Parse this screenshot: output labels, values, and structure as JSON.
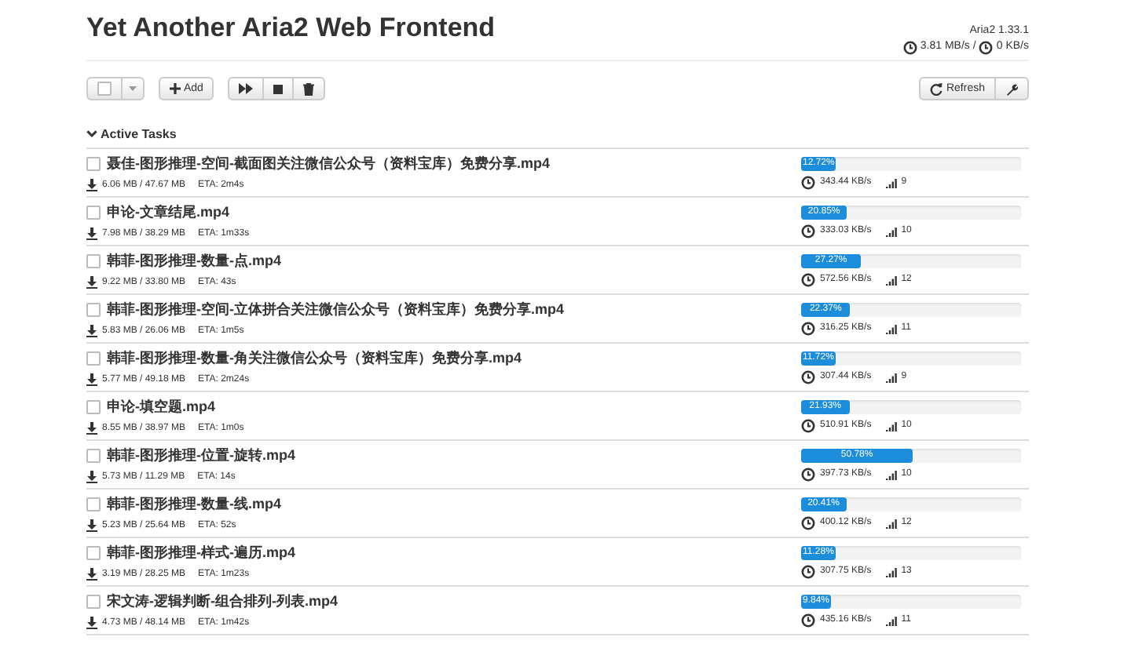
{
  "header": {
    "title": "Yet Another Aria2 Web Frontend",
    "version": "Aria2 1.33.1",
    "download_speed": "3.81 MB/s",
    "separator": "/",
    "upload_speed": "0 KB/s"
  },
  "toolbar": {
    "select_all": {
      "checked": false
    },
    "add_label": "Add",
    "refresh_label": "Refresh"
  },
  "section": {
    "title": "Active Tasks",
    "expanded": true
  },
  "tasks": [
    {
      "name": "聂佳-图形推理-空间-截面图关注微信公众号（资料宝库）免费分享.mp4",
      "checked": false,
      "size": "6.06 MB / 47.67 MB",
      "eta": "ETA: 2m4s",
      "level": 0.1272,
      "percent": "12.72%",
      "speed": "343.44 KB/s",
      "connections": "9"
    },
    {
      "name": "申论-文章结尾.mp4",
      "checked": false,
      "size": "7.98 MB / 38.29 MB",
      "eta": "ETA: 1m33s",
      "level": 0.2085,
      "percent": "20.85%",
      "speed": "333.03 KB/s",
      "connections": "10"
    },
    {
      "name": "韩菲-图形推理-数量-点.mp4",
      "checked": false,
      "size": "9.22 MB / 33.80 MB",
      "eta": "ETA: 43s",
      "level": 0.2727,
      "percent": "27.27%",
      "speed": "572.56 KB/s",
      "connections": "12"
    },
    {
      "name": "韩菲-图形推理-空间-立体拼合关注微信公众号（资料宝库）免费分享.mp4",
      "checked": false,
      "size": "5.83 MB / 26.06 MB",
      "eta": "ETA: 1m5s",
      "level": 0.2237,
      "percent": "22.37%",
      "speed": "316.25 KB/s",
      "connections": "11"
    },
    {
      "name": "韩菲-图形推理-数量-角关注微信公众号（资料宝库）免费分享.mp4",
      "checked": false,
      "size": "5.77 MB / 49.18 MB",
      "eta": "ETA: 2m24s",
      "level": 0.1172,
      "percent": "11.72%",
      "speed": "307.44 KB/s",
      "connections": "9"
    },
    {
      "name": "申论-填空题.mp4",
      "checked": false,
      "size": "8.55 MB / 38.97 MB",
      "eta": "ETA: 1m0s",
      "level": 0.2193,
      "percent": "21.93%",
      "speed": "510.91 KB/s",
      "connections": "10"
    },
    {
      "name": "韩菲-图形推理-位置-旋转.mp4",
      "checked": false,
      "size": "5.73 MB / 11.29 MB",
      "eta": "ETA: 14s",
      "level": 0.5078,
      "percent": "50.78%",
      "speed": "397.73 KB/s",
      "connections": "10"
    },
    {
      "name": "韩菲-图形推理-数量-线.mp4",
      "checked": false,
      "size": "5.23 MB / 25.64 MB",
      "eta": "ETA: 52s",
      "level": 0.2041,
      "percent": "20.41%",
      "speed": "400.12 KB/s",
      "connections": "12"
    },
    {
      "name": "韩菲-图形推理-样式-遍历.mp4",
      "checked": false,
      "size": "3.19 MB / 28.25 MB",
      "eta": "ETA: 1m23s",
      "level": 0.1128,
      "percent": "11.28%",
      "speed": "307.75 KB/s",
      "connections": "13"
    },
    {
      "name": "宋文涛-逻辑判断-组合排列-列表.mp4",
      "checked": false,
      "size": "4.73 MB / 48.14 MB",
      "eta": "ETA: 1m42s",
      "level": 0.0984,
      "percent": "9.84%",
      "speed": "435.16 KB/s",
      "connections": "11"
    }
  ]
}
